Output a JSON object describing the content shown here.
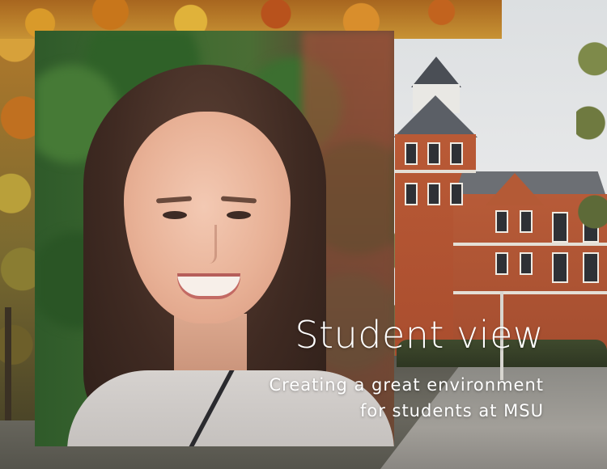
{
  "hero": {
    "title": "Student view",
    "subtitle_lines": [
      "Creating a great environment",
      "for students at MSU"
    ]
  },
  "images": {
    "background": "campus-building-autumn",
    "portrait": "smiling-person-portrait"
  },
  "colors": {
    "text": "#ffffff",
    "brick": "#b95a36"
  }
}
